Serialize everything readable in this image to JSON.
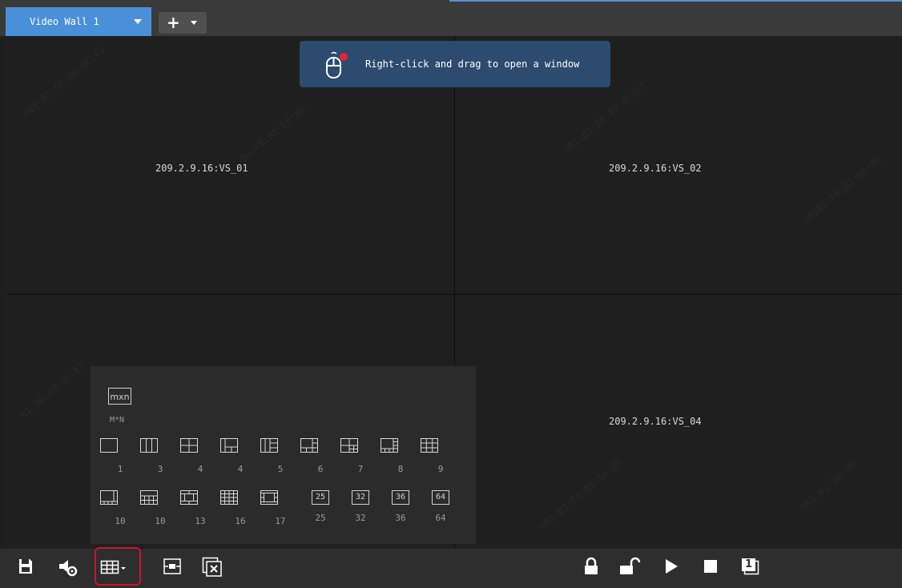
{
  "tabs": {
    "active_label": "Video Wall 1"
  },
  "hint": {
    "text": "Right-click and drag to open a window"
  },
  "screens": [
    {
      "label": "209.2.9.16:VS_01"
    },
    {
      "label": "209.2.9.16:VS_02"
    },
    {
      "label": ""
    },
    {
      "label": "209.2.9.16:VS_04"
    }
  ],
  "layout_panel": {
    "custom_icon_text": "mxn",
    "custom_label": "M*N",
    "row1": [
      "1",
      "3",
      "4",
      "4",
      "5",
      "6",
      "7",
      "8",
      "9"
    ],
    "row2": [
      "10",
      "10",
      "13",
      "16",
      "17",
      "25",
      "32",
      "36",
      "64"
    ],
    "row2_box_labels": [
      "25",
      "32",
      "36",
      "64"
    ]
  },
  "toolbar": {
    "left": [
      "save-icon",
      "volume-settings-icon",
      "layout-grid-icon",
      "fit-window-icon",
      "clear-windows-icon"
    ],
    "right": [
      "lock-icon",
      "unlock-icon",
      "play-icon",
      "stop-icon",
      "screen-number-icon"
    ],
    "screen_number_text": "1"
  },
  "colors": {
    "tab_blue": "#4a90d9",
    "hint_bg": "#2c4b6e",
    "selection_red": "#c8162a"
  }
}
